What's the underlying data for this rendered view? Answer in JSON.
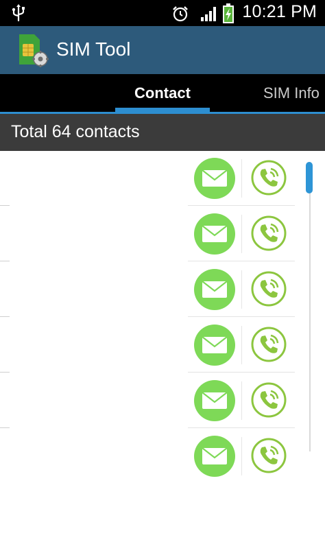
{
  "status_bar": {
    "time": "10:21 PM",
    "icons": [
      "usb-icon",
      "alarm-icon",
      "signal-icon",
      "battery-charging-icon"
    ]
  },
  "action_bar": {
    "title": "SIM Tool",
    "icon": "sim-card-icon"
  },
  "tabs": [
    {
      "label": "Contact",
      "selected": true
    },
    {
      "label": "SIM Info",
      "selected": false
    }
  ],
  "summary": {
    "text": "Total 64 contacts"
  },
  "contacts": {
    "row_count": 6,
    "actions": [
      "message-icon",
      "call-icon"
    ],
    "action_color": "#7ed957"
  },
  "colors": {
    "action_bar": "#2d5a7b",
    "tab_indicator": "#2d8ed0",
    "summary_bar": "#3b3b3b"
  }
}
